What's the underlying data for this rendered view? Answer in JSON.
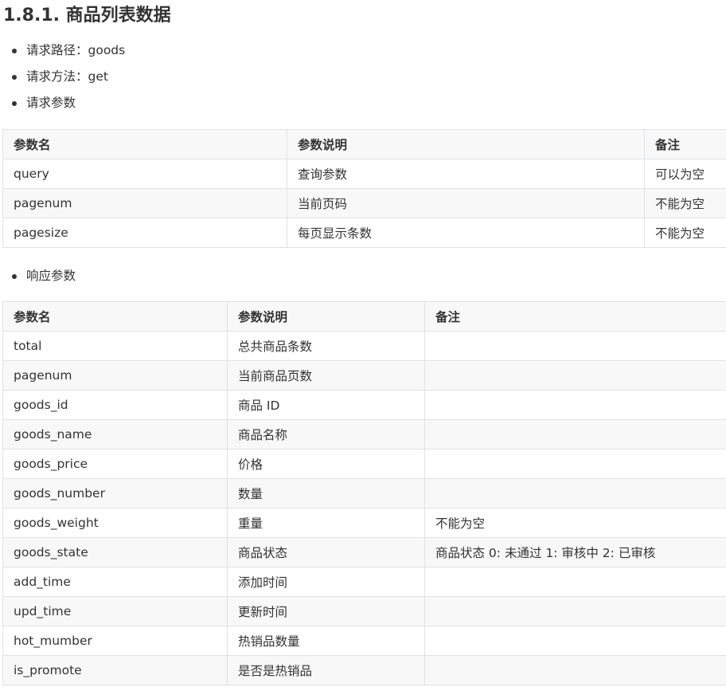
{
  "section": {
    "title": "1.8.1. 商品列表数据"
  },
  "request": {
    "items": [
      "请求路径：goods",
      "请求方法：get",
      "请求参数"
    ],
    "table": {
      "headers": [
        "参数名",
        "参数说明",
        "备注"
      ],
      "rows": [
        [
          "query",
          "查询参数",
          "可以为空"
        ],
        [
          "pagenum",
          "当前页码",
          "不能为空"
        ],
        [
          "pagesize",
          "每页显示条数",
          "不能为空"
        ]
      ]
    }
  },
  "response": {
    "label": "响应参数",
    "table": {
      "headers": [
        "参数名",
        "参数说明",
        "备注"
      ],
      "rows": [
        [
          "total",
          "总共商品条数",
          ""
        ],
        [
          "pagenum",
          "当前商品页数",
          ""
        ],
        [
          "goods_id",
          "商品 ID",
          ""
        ],
        [
          "goods_name",
          "商品名称",
          ""
        ],
        [
          "goods_price",
          "价格",
          ""
        ],
        [
          "goods_number",
          "数量",
          ""
        ],
        [
          "goods_weight",
          "重量",
          "不能为空"
        ],
        [
          "goods_state",
          "商品状态",
          "商品状态 0: 未通过 1: 审核中 2: 已审核"
        ],
        [
          "add_time",
          "添加时间",
          ""
        ],
        [
          "upd_time",
          "更新时间",
          ""
        ],
        [
          "hot_mumber",
          "热销品数量",
          ""
        ],
        [
          "is_promote",
          "是否是热销品",
          ""
        ]
      ]
    }
  }
}
